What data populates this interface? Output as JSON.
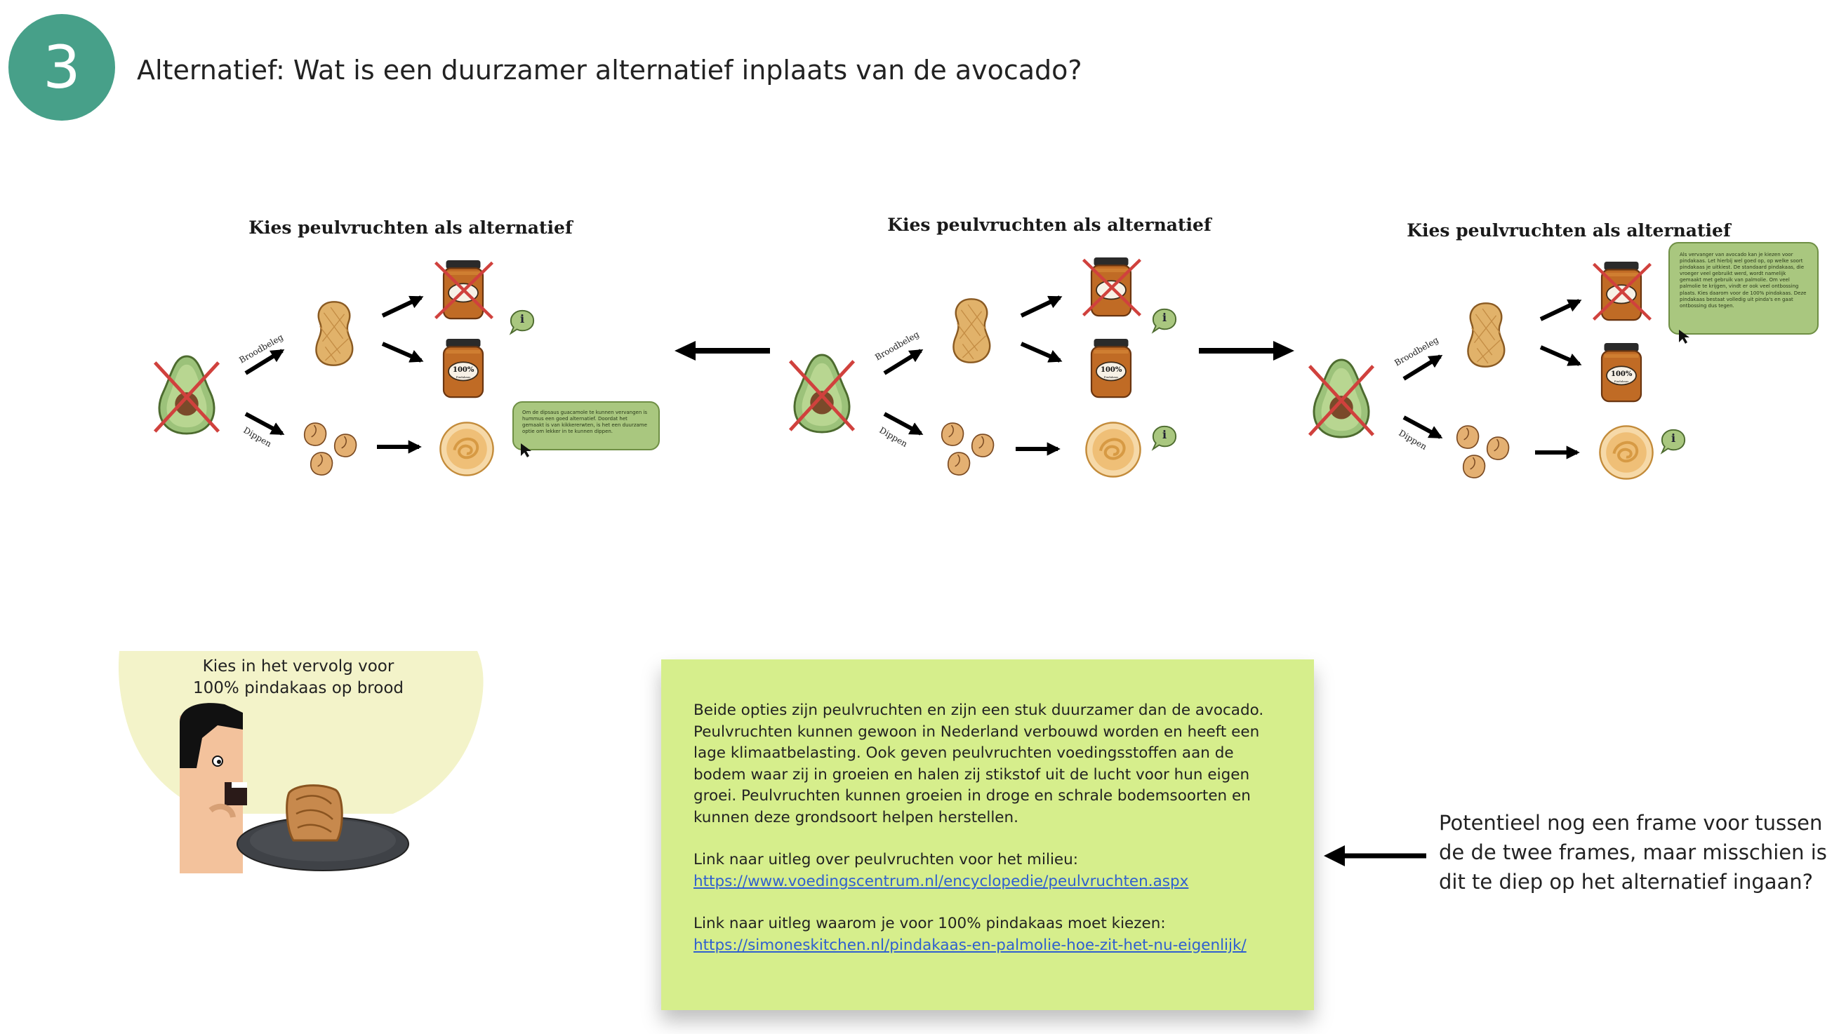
{
  "step": {
    "number": "3",
    "title": "Alternatief: Wat is een duurzamer alternatief inplaats van de avocado?"
  },
  "frames": [
    {
      "title": "Kies peulvruchten als alternatief",
      "label_top": "Broodbeleg",
      "label_bottom": "Dippen",
      "bubble_text": "Om de dipsaus guacamole te kunnen vervangen is hummus een goed alternatief. Doordat het gemaakt is van kikkererwten, is het een duurzame optie om lekker in te kunnen dippen."
    },
    {
      "title": "Kies peulvruchten als alternatief",
      "label_top": "Broodbeleg",
      "label_bottom": "Dippen",
      "bubble_text": ""
    },
    {
      "title": "Kies peulvruchten als alternatief",
      "label_top": "Broodbeleg",
      "label_bottom": "Dippen",
      "bubble_text": "Als vervanger van avocado kan je kiezen voor pindakaas. Let hierbij wel goed op, op welke soort pindakaas je uitkiest. De standaard pindakaas, die vroeger veel gebruikt werd, wordt namelijk gemaakt met gebruik van palmolie. Om veel palmolie te krijgen, vindt er ook veel ontbossing plaats. Kies daarom voor de 100% pindakaas. Deze pindakaas bestaat volledig uit pinda's en gaat ontbossing dus tegen."
    }
  ],
  "jar_label": "100%",
  "jar_sublabel": "Pindakaas",
  "info_symbol": "i",
  "scene": {
    "caption": "Kies in het vervolg voor 100% pindakaas op brood"
  },
  "note": {
    "paragraph": "Beide opties zijn peulvruchten en zijn een stuk duurzamer dan de avocado. Peulvruchten kunnen gewoon in Nederland verbouwd worden en heeft een lage klimaatbelasting. Ook geven peulvruchten voedingsstoffen aan de bodem waar zij in groeien en halen zij stikstof uit de lucht voor hun eigen groei. Peulvruchten kunnen groeien in droge en schrale bodemsoorten en kunnen deze grondsoort helpen herstellen.",
    "link1_intro": "Link naar uitleg over peulvruchten voor het milieu:",
    "link1_url": "https://www.voedingscentrum.nl/encyclopedie/peulvruchten.aspx",
    "link2_intro": "Link naar uitleg waarom je voor 100% pindakaas moet kiezen:",
    "link2_url": "https://simoneskitchen.nl/pindakaas-en-palmolie-hoe-zit-het-nu-eigenlijk/"
  },
  "side_note": "Potentieel nog een frame voor tussen de de twee frames, maar misschien is dit te diep op het alternatief ingaan?",
  "colors": {
    "accent": "#47a089",
    "note_bg": "#d6ee8c",
    "bubble": "#a9c77f",
    "cross": "#d0413d",
    "avocado": "#9cc27a",
    "jar": "#c06b25",
    "peanut": "#e1b26a"
  }
}
